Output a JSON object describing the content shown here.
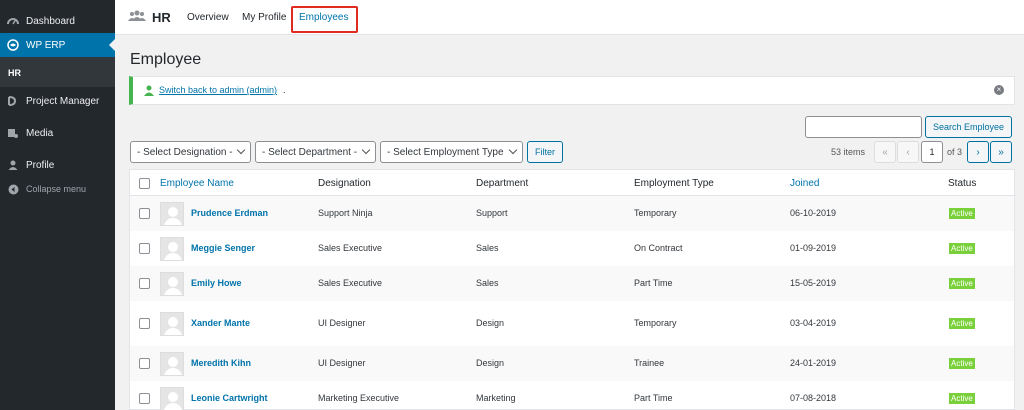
{
  "sidebar": {
    "items": [
      {
        "label": "Dashboard",
        "icon": "dashboard-icon"
      },
      {
        "label": "WP ERP",
        "icon": "wp-erp-icon"
      },
      {
        "label": "Project Manager",
        "icon": "project-manager-icon"
      },
      {
        "label": "Media",
        "icon": "media-icon"
      },
      {
        "label": "Profile",
        "icon": "profile-icon"
      }
    ],
    "submenu_item": "HR",
    "collapse_label": "Collapse menu"
  },
  "topnav": {
    "brand": "HR",
    "links": [
      "Overview",
      "My Profile",
      "Employees"
    ],
    "active": "Employees"
  },
  "page_title": "Employee",
  "notice": {
    "link_text": "Switch back to admin (admin)",
    "suffix": ".",
    "accent": "#46b450"
  },
  "search": {
    "placeholder": "",
    "button_label": "Search Employee"
  },
  "filters": {
    "designation": "- Select Designation -",
    "department": "- Select Department -",
    "employment_type": "- Select Employment Type",
    "button_label": "Filter"
  },
  "pagination": {
    "item_count": "53 items",
    "first": "«",
    "prev": "‹",
    "current_page": "1",
    "of_total": "of 3",
    "next": "›",
    "last": "»"
  },
  "table": {
    "columns": [
      "Employee Name",
      "Designation",
      "Department",
      "Employment Type",
      "Joined",
      "Status"
    ],
    "rows": [
      {
        "name": "Prudence Erdman",
        "designation": "Support Ninja",
        "department": "Support",
        "type": "Temporary",
        "joined": "06-10-2019",
        "status": "Active"
      },
      {
        "name": "Meggie Senger",
        "designation": "Sales Executive",
        "department": "Sales",
        "type": "On Contract",
        "joined": "01-09-2019",
        "status": "Active"
      },
      {
        "name": "Emily Howe",
        "designation": "Sales Executive",
        "department": "Sales",
        "type": "Part Time",
        "joined": "15-05-2019",
        "status": "Active"
      },
      {
        "name": "Xander Mante",
        "designation": "UI Designer",
        "department": "Design",
        "type": "Temporary",
        "joined": "03-04-2019",
        "status": "Active"
      },
      {
        "name": "Meredith Kihn",
        "designation": "UI Designer",
        "department": "Design",
        "type": "Trainee",
        "joined": "24-01-2019",
        "status": "Active"
      },
      {
        "name": "Leonie Cartwright",
        "designation": "Marketing Executive",
        "department": "Marketing",
        "type": "Part Time",
        "joined": "07-08-2018",
        "status": "Active"
      }
    ]
  },
  "colors": {
    "sidebar_bg": "#23282d",
    "active_menu": "#0073aa",
    "link": "#0073aa",
    "status_active": "#7ad03a",
    "highlight_box": "#e02b20"
  }
}
